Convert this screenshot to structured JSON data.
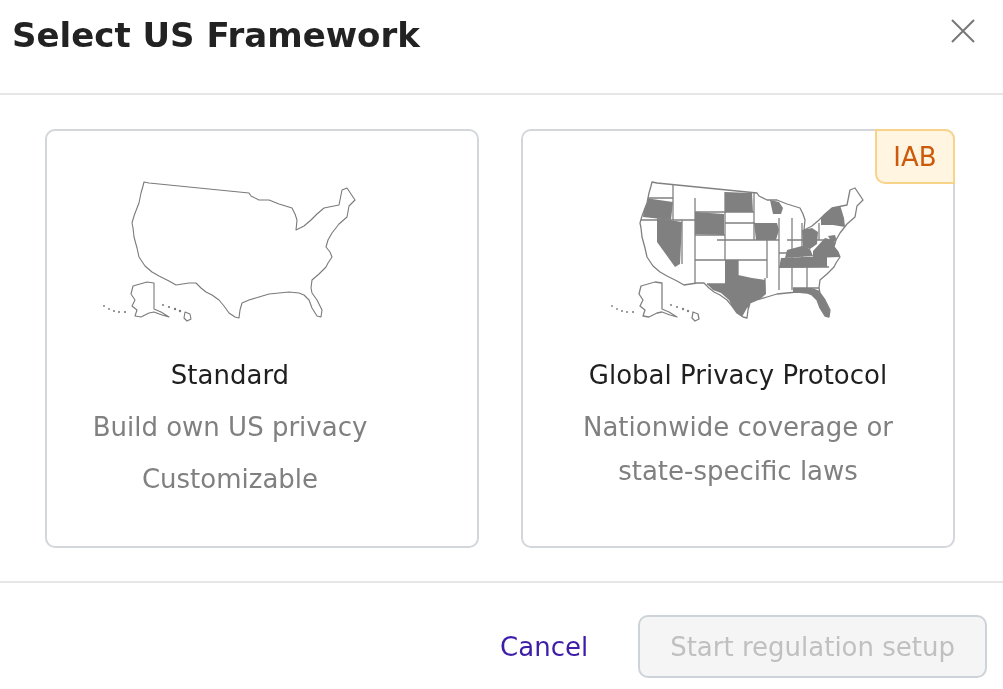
{
  "dialog": {
    "title": "Select US Framework"
  },
  "cards": [
    {
      "kind": "outline",
      "title": "Standard",
      "description": [
        "Build own US privacy",
        "Customizable"
      ],
      "selected": false
    },
    {
      "kind": "states",
      "title": "Global Privacy Protocol",
      "description": [
        "Nationwide coverage or state-specific laws"
      ],
      "badge": "IAB",
      "selected": false
    }
  ],
  "footer": {
    "cancel": "Cancel",
    "primary": {
      "label": "Start regulation setup",
      "disabled": true
    }
  }
}
